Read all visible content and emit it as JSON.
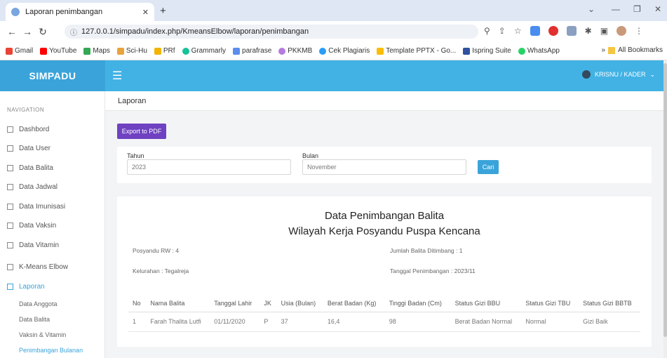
{
  "browser": {
    "tab_title": "Laporan penimbangan",
    "url": "127.0.0.1/simpadu/index.php/KmeansElbow/laporan/penimbangan",
    "bookmarks": [
      "Gmail",
      "YouTube",
      "Maps",
      "Sci-Hu",
      "PRf",
      "Grammarly",
      "parafrase",
      "PKKMB",
      "Cek Plagiaris",
      "Template PPTX - Go...",
      "Ispring Suite",
      "WhatsApp"
    ],
    "all_bookmarks": "All Bookmarks"
  },
  "header": {
    "brand": "SIMPADU",
    "user": "KRISNU / KADER"
  },
  "sidebar": {
    "heading": "NAVIGATION",
    "items": [
      "Dashbord",
      "Data User",
      "Data Balita",
      "Data Jadwal",
      "Data Imunisasi",
      "Data Vaksin",
      "Data Vitamin",
      "K-Means Elbow",
      "Laporan"
    ],
    "sub_items": [
      "Data Anggota",
      "Data Balita",
      "Vaksin & Vitamin",
      "Penimbangan Bulanan"
    ]
  },
  "page": {
    "title": "Laporan",
    "export_label": "Export to PDF",
    "tahun_label": "Tahun",
    "tahun_value": "2023",
    "bulan_label": "Bulan",
    "bulan_value": "November",
    "cari_label": "Cari"
  },
  "report": {
    "title1": "Data Penimbangan Balita",
    "title2": "Wilayah Kerja Posyandu Puspa Kencana",
    "posyandu": "Posyandu RW : 4",
    "jumlah": "Jumlah Balita Ditimbang : 1",
    "kelurahan": "Kelurahan : Tegalreja",
    "tanggal": "Tanggal Penimbangan : 2023/11",
    "columns": [
      "No",
      "Nama Balita",
      "Tanggal Lahir",
      "JK",
      "Usia (Bulan)",
      "Berat Badan (Kg)",
      "Tinggi Badan (Cm)",
      "Status Gizi BBU",
      "Status Gizi TBU",
      "Status Gizi BBTB"
    ],
    "rows": [
      [
        "1",
        "Farah Thalita Lutfi",
        "01/11/2020",
        "P",
        "37",
        "16,4",
        "98",
        "Berat Badan Normal",
        "Normal",
        "Gizi Baik"
      ]
    ]
  },
  "colors": {
    "header_blue": "#42b2e5",
    "brand_blue": "#3aa4da",
    "export_purple": "#6f42c1"
  }
}
